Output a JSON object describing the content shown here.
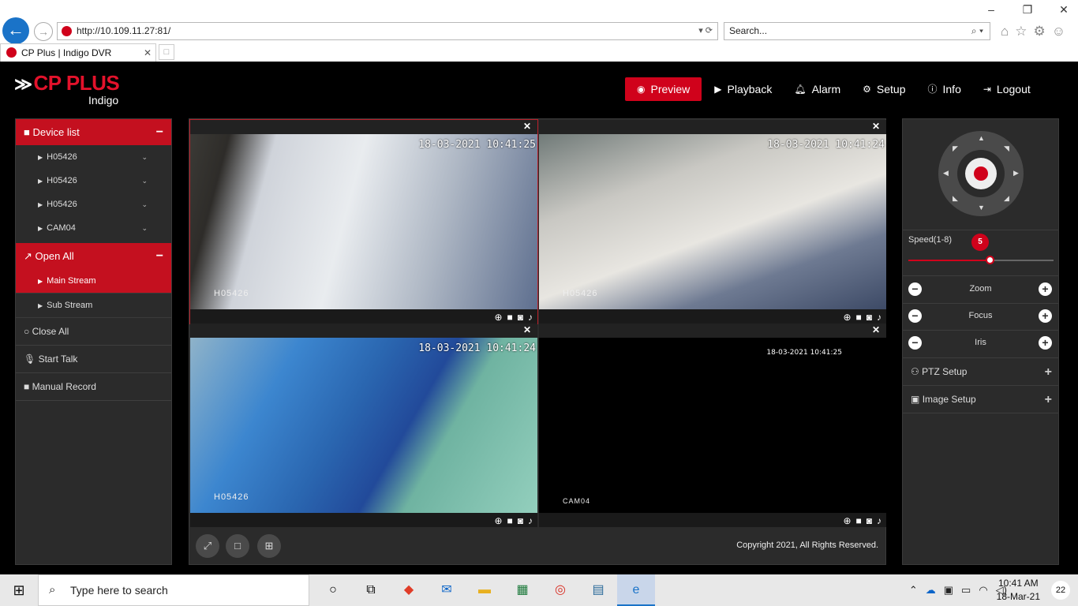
{
  "browser": {
    "url": "http://10.109.11.27:81/",
    "search_placeholder": "Search...",
    "tab_title": "CP Plus | Indigo DVR"
  },
  "logo": {
    "brand": "CP PLUS",
    "subtitle": "Indigo"
  },
  "nav": [
    {
      "label": "Preview",
      "icon": "eye-icon",
      "active": true
    },
    {
      "label": "Playback",
      "icon": "play-circle-icon"
    },
    {
      "label": "Alarm",
      "icon": "bell-icon"
    },
    {
      "label": "Setup",
      "icon": "gear-icon"
    },
    {
      "label": "Info",
      "icon": "info-icon"
    },
    {
      "label": "Logout",
      "icon": "logout-icon"
    }
  ],
  "left_panel": {
    "device_list_label": "Device list",
    "devices": [
      "H05426",
      "H05426",
      "H05426",
      "CAM04"
    ],
    "open_all_label": "Open All",
    "streams": [
      {
        "label": "Main Stream",
        "active": true
      },
      {
        "label": "Sub Stream",
        "active": false
      }
    ],
    "close_all_label": "Close All",
    "start_talk_label": "Start Talk",
    "manual_record_label": "Manual Record"
  },
  "cameras": [
    {
      "timestamp": "18-03-2021 10:41:25",
      "channel": "H05426",
      "selected": true
    },
    {
      "timestamp": "18-03-2021 10:41:24",
      "channel": "H05426",
      "selected": false
    },
    {
      "timestamp": "18-03-2021 10:41:24",
      "channel": "H05426",
      "selected": false
    },
    {
      "timestamp": "18-03-2021 10:41:25",
      "channel": "CAM04",
      "selected": false
    }
  ],
  "copyright": "Copyright 2021, All Rights Reserved.",
  "right_panel": {
    "speed_label": "Speed(1-8)",
    "speed_value": "5",
    "speed_level": 5,
    "speed_max": 8,
    "zoom_label": "Zoom",
    "focus_label": "Focus",
    "iris_label": "Iris",
    "ptz_setup_label": "PTZ Setup",
    "image_setup_label": "Image Setup"
  },
  "taskbar": {
    "search_placeholder": "Type here to search",
    "time": "10:41 AM",
    "date": "18-Mar-21",
    "notification_count": "22"
  }
}
